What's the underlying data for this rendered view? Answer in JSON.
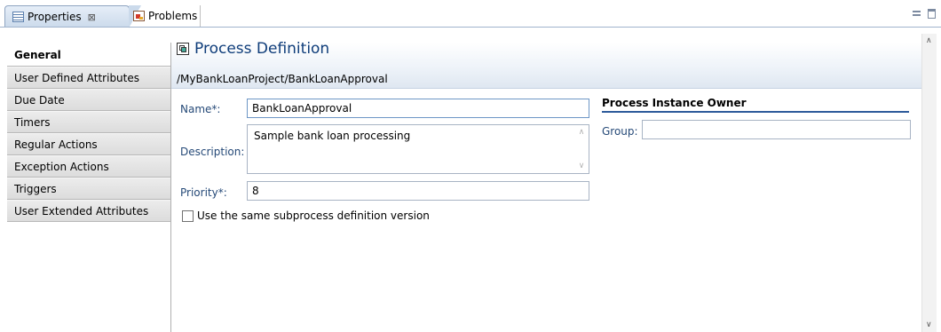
{
  "tabs": [
    {
      "label": "Properties",
      "icon": "table-icon",
      "active": true,
      "closable": true
    },
    {
      "label": "Problems",
      "icon": "problems-icon",
      "active": false
    }
  ],
  "close_glyph": "⊠",
  "view_controls": [
    "view-menu-icon",
    "minimize-icon",
    "maximize-icon"
  ],
  "sidebar": {
    "items": [
      {
        "label": "General",
        "active": true
      },
      {
        "label": "User Defined Attributes"
      },
      {
        "label": "Due Date"
      },
      {
        "label": "Timers"
      },
      {
        "label": "Regular Actions"
      },
      {
        "label": "Exception Actions"
      },
      {
        "label": "Triggers"
      },
      {
        "label": "User Extended Attributes"
      }
    ]
  },
  "section": {
    "title": "Process Definition",
    "icon": "process-definition-icon",
    "path": "/MyBankLoanProject/BankLoanApproval"
  },
  "form": {
    "name_label": "Name*:",
    "name_value": "BankLoanApproval",
    "description_label": "Description:",
    "description_value": "Sample bank loan processing",
    "priority_label": "Priority*:",
    "priority_value": "8",
    "checkbox_label": "Use the same subprocess definition version",
    "checkbox_checked": false
  },
  "owner": {
    "title": "Process Instance Owner",
    "group_label": "Group:",
    "group_value": ""
  },
  "colors": {
    "title": "#0f3d7a",
    "label": "#264a78",
    "accent_line": "#2d5a9a"
  }
}
